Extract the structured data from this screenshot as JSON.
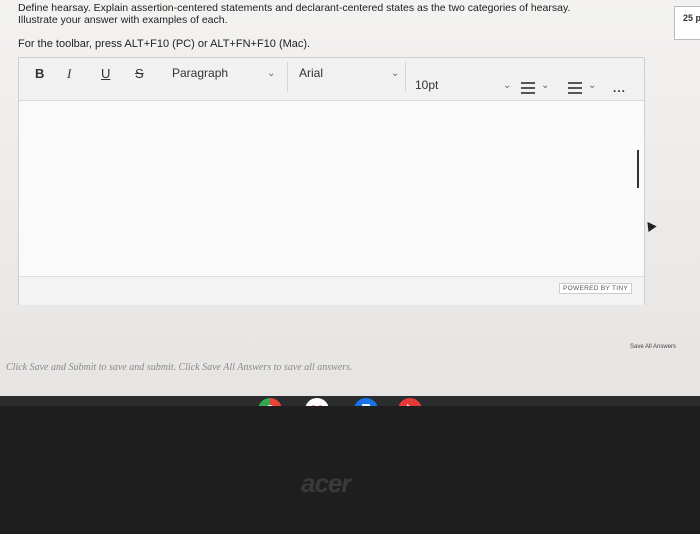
{
  "question": {
    "line1": "Define hearsay. Explain assertion-centered statements and declarant-centered states as the two categories of hearsay.",
    "line2": "Illustrate your answer with examples of each.",
    "points": "25 p"
  },
  "toolbar_hint": "For the toolbar, press ALT+F10 (PC) or ALT+FN+F10 (Mac).",
  "toolbar": {
    "bold": "B",
    "italic": "I",
    "underline": "U",
    "strike": "S",
    "paragraph": "Paragraph",
    "font": "Arial",
    "size": "10pt",
    "more": "..."
  },
  "editor": {
    "powered_by": "POWERED BY TINY"
  },
  "save_all": "Save All Answers",
  "footer_note": "Click Save and Submit to save and submit. Click Save All Answers to save all answers.",
  "laptop_brand": "acer",
  "icons": [
    "chevron-down-icon",
    "bullet-list-icon",
    "numbered-list-icon",
    "chrome-icon",
    "gmail-icon",
    "files-icon",
    "play-store-icon"
  ],
  "colors": {
    "chrome_red": "#ea4335",
    "gmail_red": "#d93025",
    "files_blue": "#1a73e8",
    "play_red": "#e53935"
  }
}
